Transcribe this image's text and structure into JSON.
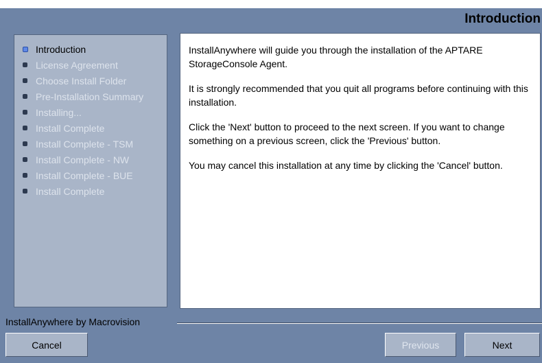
{
  "header": {
    "title": "Introduction"
  },
  "steps": [
    {
      "label": "Introduction",
      "current": true
    },
    {
      "label": "License Agreement"
    },
    {
      "label": "Choose Install Folder"
    },
    {
      "label": "Pre-Installation Summary"
    },
    {
      "label": "Installing..."
    },
    {
      "label": "Install Complete"
    },
    {
      "label": "Install Complete - TSM"
    },
    {
      "label": "Install Complete - NW"
    },
    {
      "label": "Install Complete - BUE"
    },
    {
      "label": "Install Complete"
    }
  ],
  "content": {
    "paragraphs": [
      "InstallAnywhere will guide you through the installation of the APTARE StorageConsole Agent.",
      "It is strongly recommended that you quit all programs before continuing with this installation.",
      "Click the 'Next' button to proceed to the next screen. If you want to change something on a previous screen, click the 'Previous' button.",
      "You may cancel this installation at any time by clicking the 'Cancel' button."
    ]
  },
  "footer": {
    "brand": "InstallAnywhere by Macrovision",
    "cancel_label": "Cancel",
    "previous_label": "Previous",
    "next_label": "Next"
  },
  "colors": {
    "frame": "#6e84a6",
    "sidebar": "#a9b5c8",
    "current_bullet": "#5f88e6"
  }
}
